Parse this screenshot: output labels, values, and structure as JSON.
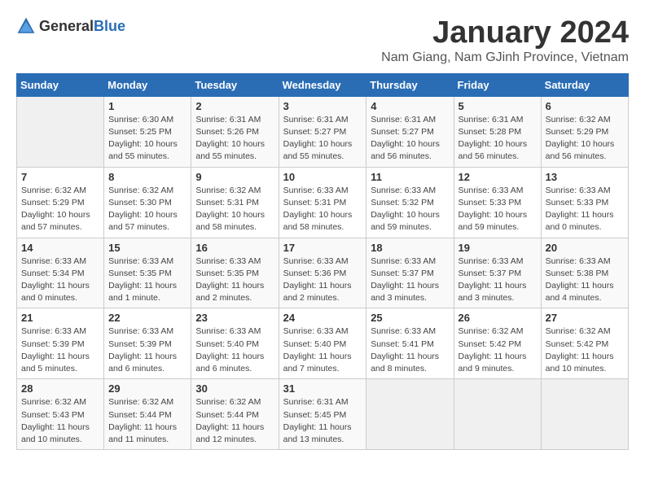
{
  "logo": {
    "text_general": "General",
    "text_blue": "Blue"
  },
  "title": "January 2024",
  "location": "Nam Giang, Nam GJinh Province, Vietnam",
  "days_of_week": [
    "Sunday",
    "Monday",
    "Tuesday",
    "Wednesday",
    "Thursday",
    "Friday",
    "Saturday"
  ],
  "weeks": [
    [
      {
        "day": "",
        "info": ""
      },
      {
        "day": "1",
        "info": "Sunrise: 6:30 AM\nSunset: 5:25 PM\nDaylight: 10 hours\nand 55 minutes."
      },
      {
        "day": "2",
        "info": "Sunrise: 6:31 AM\nSunset: 5:26 PM\nDaylight: 10 hours\nand 55 minutes."
      },
      {
        "day": "3",
        "info": "Sunrise: 6:31 AM\nSunset: 5:27 PM\nDaylight: 10 hours\nand 55 minutes."
      },
      {
        "day": "4",
        "info": "Sunrise: 6:31 AM\nSunset: 5:27 PM\nDaylight: 10 hours\nand 56 minutes."
      },
      {
        "day": "5",
        "info": "Sunrise: 6:31 AM\nSunset: 5:28 PM\nDaylight: 10 hours\nand 56 minutes."
      },
      {
        "day": "6",
        "info": "Sunrise: 6:32 AM\nSunset: 5:29 PM\nDaylight: 10 hours\nand 56 minutes."
      }
    ],
    [
      {
        "day": "7",
        "info": "Sunrise: 6:32 AM\nSunset: 5:29 PM\nDaylight: 10 hours\nand 57 minutes."
      },
      {
        "day": "8",
        "info": "Sunrise: 6:32 AM\nSunset: 5:30 PM\nDaylight: 10 hours\nand 57 minutes."
      },
      {
        "day": "9",
        "info": "Sunrise: 6:32 AM\nSunset: 5:31 PM\nDaylight: 10 hours\nand 58 minutes."
      },
      {
        "day": "10",
        "info": "Sunrise: 6:33 AM\nSunset: 5:31 PM\nDaylight: 10 hours\nand 58 minutes."
      },
      {
        "day": "11",
        "info": "Sunrise: 6:33 AM\nSunset: 5:32 PM\nDaylight: 10 hours\nand 59 minutes."
      },
      {
        "day": "12",
        "info": "Sunrise: 6:33 AM\nSunset: 5:33 PM\nDaylight: 10 hours\nand 59 minutes."
      },
      {
        "day": "13",
        "info": "Sunrise: 6:33 AM\nSunset: 5:33 PM\nDaylight: 11 hours\nand 0 minutes."
      }
    ],
    [
      {
        "day": "14",
        "info": "Sunrise: 6:33 AM\nSunset: 5:34 PM\nDaylight: 11 hours\nand 0 minutes."
      },
      {
        "day": "15",
        "info": "Sunrise: 6:33 AM\nSunset: 5:35 PM\nDaylight: 11 hours\nand 1 minute."
      },
      {
        "day": "16",
        "info": "Sunrise: 6:33 AM\nSunset: 5:35 PM\nDaylight: 11 hours\nand 2 minutes."
      },
      {
        "day": "17",
        "info": "Sunrise: 6:33 AM\nSunset: 5:36 PM\nDaylight: 11 hours\nand 2 minutes."
      },
      {
        "day": "18",
        "info": "Sunrise: 6:33 AM\nSunset: 5:37 PM\nDaylight: 11 hours\nand 3 minutes."
      },
      {
        "day": "19",
        "info": "Sunrise: 6:33 AM\nSunset: 5:37 PM\nDaylight: 11 hours\nand 3 minutes."
      },
      {
        "day": "20",
        "info": "Sunrise: 6:33 AM\nSunset: 5:38 PM\nDaylight: 11 hours\nand 4 minutes."
      }
    ],
    [
      {
        "day": "21",
        "info": "Sunrise: 6:33 AM\nSunset: 5:39 PM\nDaylight: 11 hours\nand 5 minutes."
      },
      {
        "day": "22",
        "info": "Sunrise: 6:33 AM\nSunset: 5:39 PM\nDaylight: 11 hours\nand 6 minutes."
      },
      {
        "day": "23",
        "info": "Sunrise: 6:33 AM\nSunset: 5:40 PM\nDaylight: 11 hours\nand 6 minutes."
      },
      {
        "day": "24",
        "info": "Sunrise: 6:33 AM\nSunset: 5:40 PM\nDaylight: 11 hours\nand 7 minutes."
      },
      {
        "day": "25",
        "info": "Sunrise: 6:33 AM\nSunset: 5:41 PM\nDaylight: 11 hours\nand 8 minutes."
      },
      {
        "day": "26",
        "info": "Sunrise: 6:32 AM\nSunset: 5:42 PM\nDaylight: 11 hours\nand 9 minutes."
      },
      {
        "day": "27",
        "info": "Sunrise: 6:32 AM\nSunset: 5:42 PM\nDaylight: 11 hours\nand 10 minutes."
      }
    ],
    [
      {
        "day": "28",
        "info": "Sunrise: 6:32 AM\nSunset: 5:43 PM\nDaylight: 11 hours\nand 10 minutes."
      },
      {
        "day": "29",
        "info": "Sunrise: 6:32 AM\nSunset: 5:44 PM\nDaylight: 11 hours\nand 11 minutes."
      },
      {
        "day": "30",
        "info": "Sunrise: 6:32 AM\nSunset: 5:44 PM\nDaylight: 11 hours\nand 12 minutes."
      },
      {
        "day": "31",
        "info": "Sunrise: 6:31 AM\nSunset: 5:45 PM\nDaylight: 11 hours\nand 13 minutes."
      },
      {
        "day": "",
        "info": ""
      },
      {
        "day": "",
        "info": ""
      },
      {
        "day": "",
        "info": ""
      }
    ]
  ]
}
